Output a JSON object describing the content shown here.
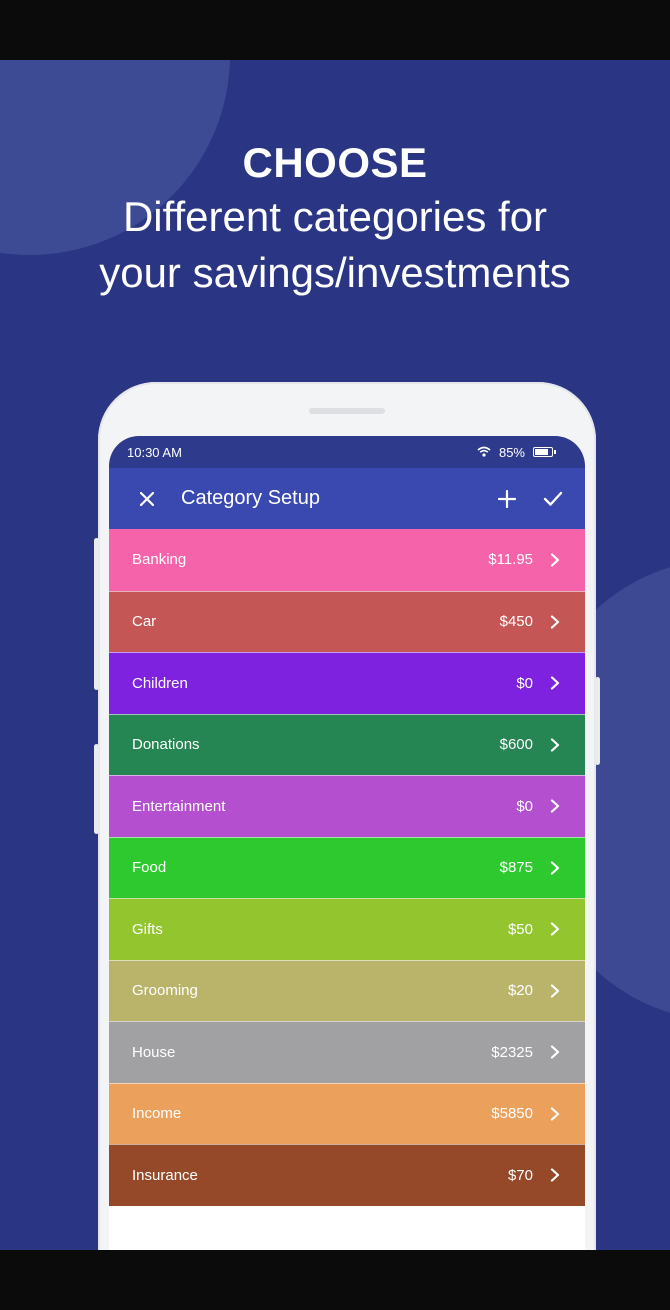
{
  "headline": {
    "title": "CHOOSE",
    "line1": "Different categories for",
    "line2": "your savings/investments"
  },
  "status_bar": {
    "time": "10:30 AM",
    "battery": "85%"
  },
  "app_bar": {
    "title": "Category Setup"
  },
  "categories": [
    {
      "name": "Banking",
      "amount": "$11.95",
      "color": "#f563ab"
    },
    {
      "name": "Car",
      "amount": "$450",
      "color": "#c45656"
    },
    {
      "name": "Children",
      "amount": "$0",
      "color": "#7e22e0"
    },
    {
      "name": "Donations",
      "amount": "$600",
      "color": "#258553"
    },
    {
      "name": "Entertainment",
      "amount": "$0",
      "color": "#b450cf"
    },
    {
      "name": "Food",
      "amount": "$875",
      "color": "#2ec92e"
    },
    {
      "name": "Gifts",
      "amount": "$50",
      "color": "#93c52f"
    },
    {
      "name": "Grooming",
      "amount": "$20",
      "color": "#b9b46a"
    },
    {
      "name": "House",
      "amount": "$2325",
      "color": "#a1a1a3"
    },
    {
      "name": "Income",
      "amount": "$5850",
      "color": "#eba05b"
    },
    {
      "name": "Insurance",
      "amount": "$70",
      "color": "#954928"
    }
  ],
  "icons": {
    "close": "close-icon",
    "add": "plus-icon",
    "confirm": "check-icon",
    "row_arrow": "chevron-right-icon",
    "wifi": "wifi-icon",
    "battery": "battery-icon"
  }
}
